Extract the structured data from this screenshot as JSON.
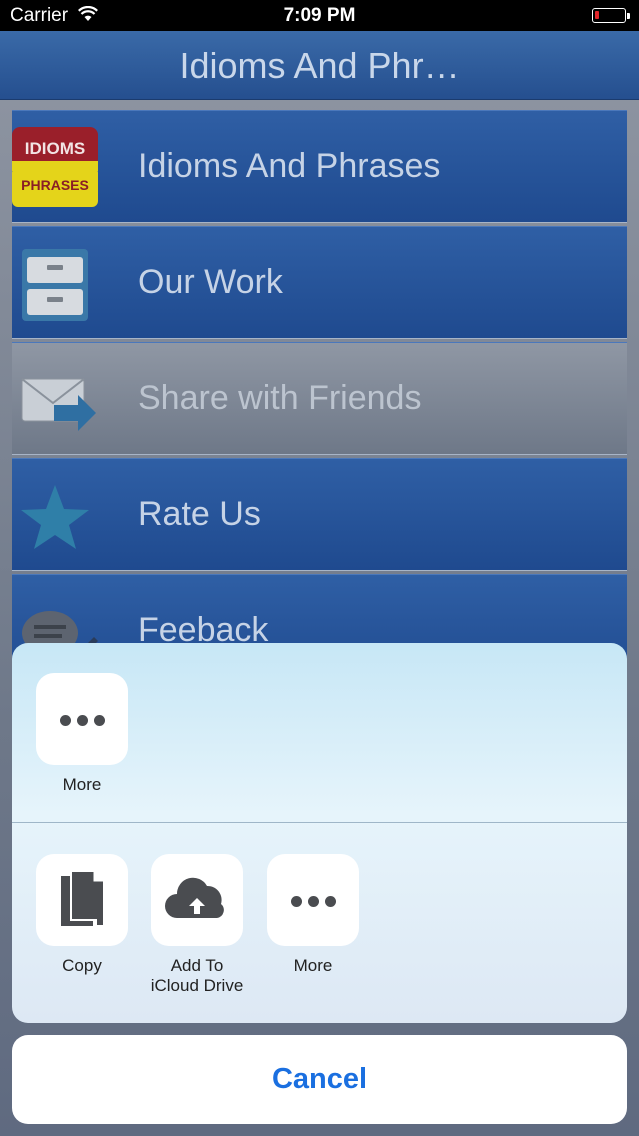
{
  "status_bar": {
    "carrier": "Carrier",
    "time": "7:09 PM",
    "battery_color": "#e0262a"
  },
  "nav": {
    "title": "Idioms And Phr…"
  },
  "menu": {
    "items": [
      {
        "label": "Idioms And Phrases",
        "icon": "idioms-phrases-logo-icon",
        "logo_top": "IDIOMS",
        "logo_bottom": "PHRASES"
      },
      {
        "label": "Our Work",
        "icon": "filing-cabinet-icon"
      },
      {
        "label": "Share with Friends",
        "icon": "envelope-arrow-icon"
      },
      {
        "label": "Rate Us",
        "icon": "star-icon"
      },
      {
        "label": "Feeback",
        "icon": "chat-bubble-pencil-icon"
      }
    ]
  },
  "share_sheet": {
    "row1": [
      {
        "label": "More",
        "icon": "more-dots-icon"
      }
    ],
    "row2": [
      {
        "label": "Copy",
        "icon": "copy-icon"
      },
      {
        "label": "Add To\niCloud Drive",
        "icon": "icloud-upload-icon"
      },
      {
        "label": "More",
        "icon": "more-dots-icon"
      }
    ],
    "cancel_label": "Cancel"
  },
  "colors": {
    "accent": "#1a6fe0",
    "nav_bar": "#2b5a9c"
  }
}
